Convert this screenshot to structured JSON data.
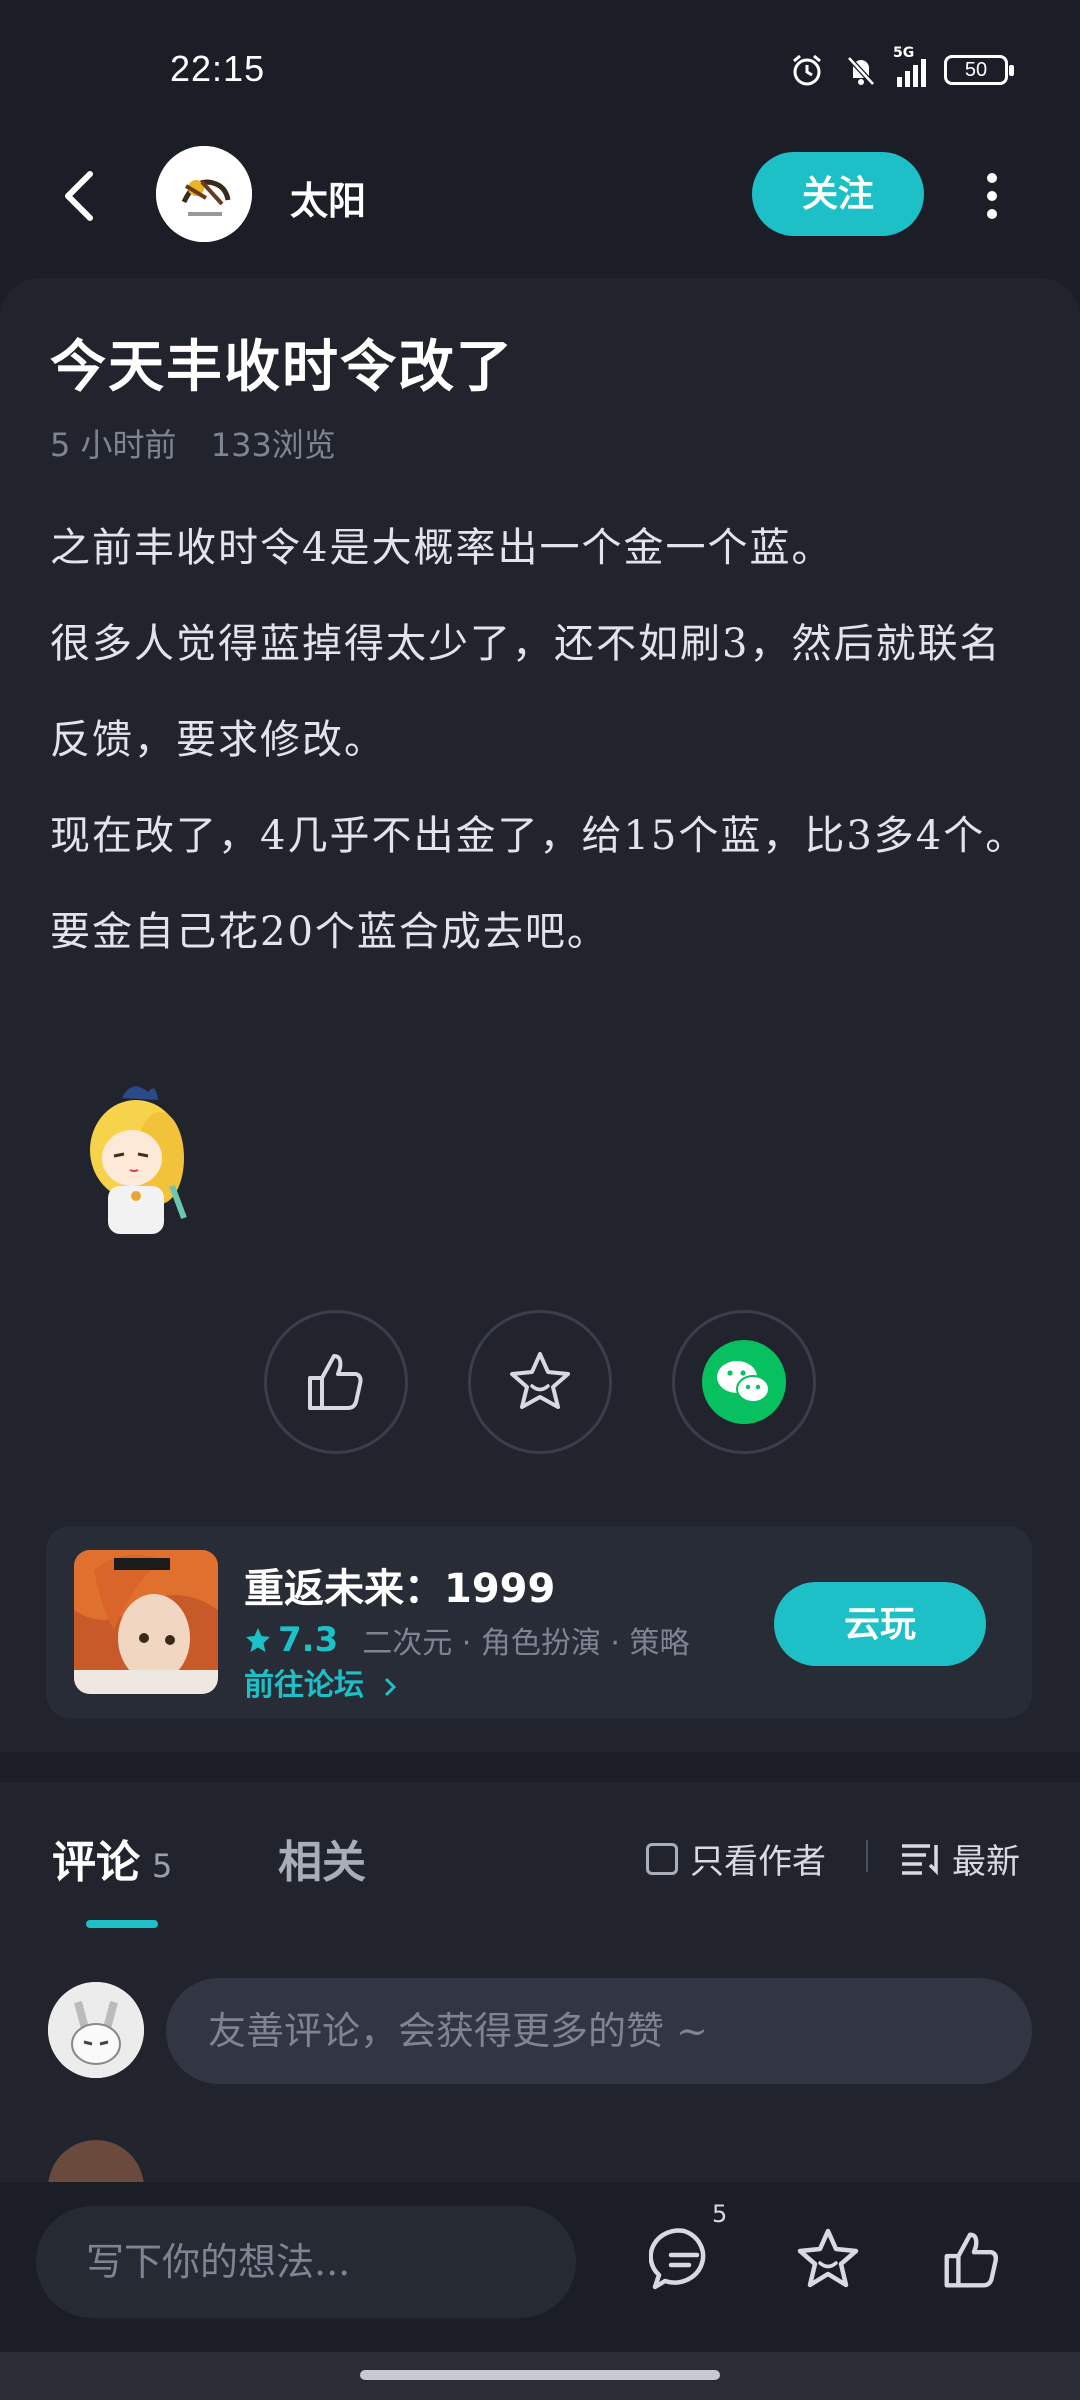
{
  "status_bar": {
    "time": "22:15",
    "network": "5G",
    "battery": "50"
  },
  "header": {
    "author_name": "太阳",
    "follow_label": "关注"
  },
  "article": {
    "title": "今天丰收时令改了",
    "time_ago": "5 小时前",
    "views": "133浏览",
    "paragraphs": [
      "之前丰收时令4是大概率出一个金一个蓝。",
      "很多人觉得蓝掉得太少了，还不如刷3，然后就联名反馈，要求修改。",
      "现在改了，4几乎不出金了，给15个蓝，比3多4个。",
      "要金自己花20个蓝合成去吧。"
    ]
  },
  "game_card": {
    "name": "重返未来：1999",
    "rating": "7.3",
    "tags": "二次元 · 角色扮演 · 策略",
    "forum_link": "前往论坛",
    "cloud_play_label": "云玩"
  },
  "comments": {
    "tab_comments_label": "评论",
    "tab_comments_count": "5",
    "tab_related_label": "相关",
    "author_only_label": "只看作者",
    "sort_label": "最新",
    "input_placeholder": "友善评论，会获得更多的赞 ~"
  },
  "bottom_bar": {
    "write_placeholder": "写下你的想法...",
    "comment_badge": "5"
  },
  "colors": {
    "accent": "#1ec0c8",
    "background": "#1b1e26",
    "card": "#21242d",
    "wechat": "#07c160"
  },
  "icons": [
    "back-icon",
    "more-icon",
    "thumbs-up-icon",
    "star-icon",
    "wechat-icon",
    "comment-icon",
    "sort-icon"
  ]
}
